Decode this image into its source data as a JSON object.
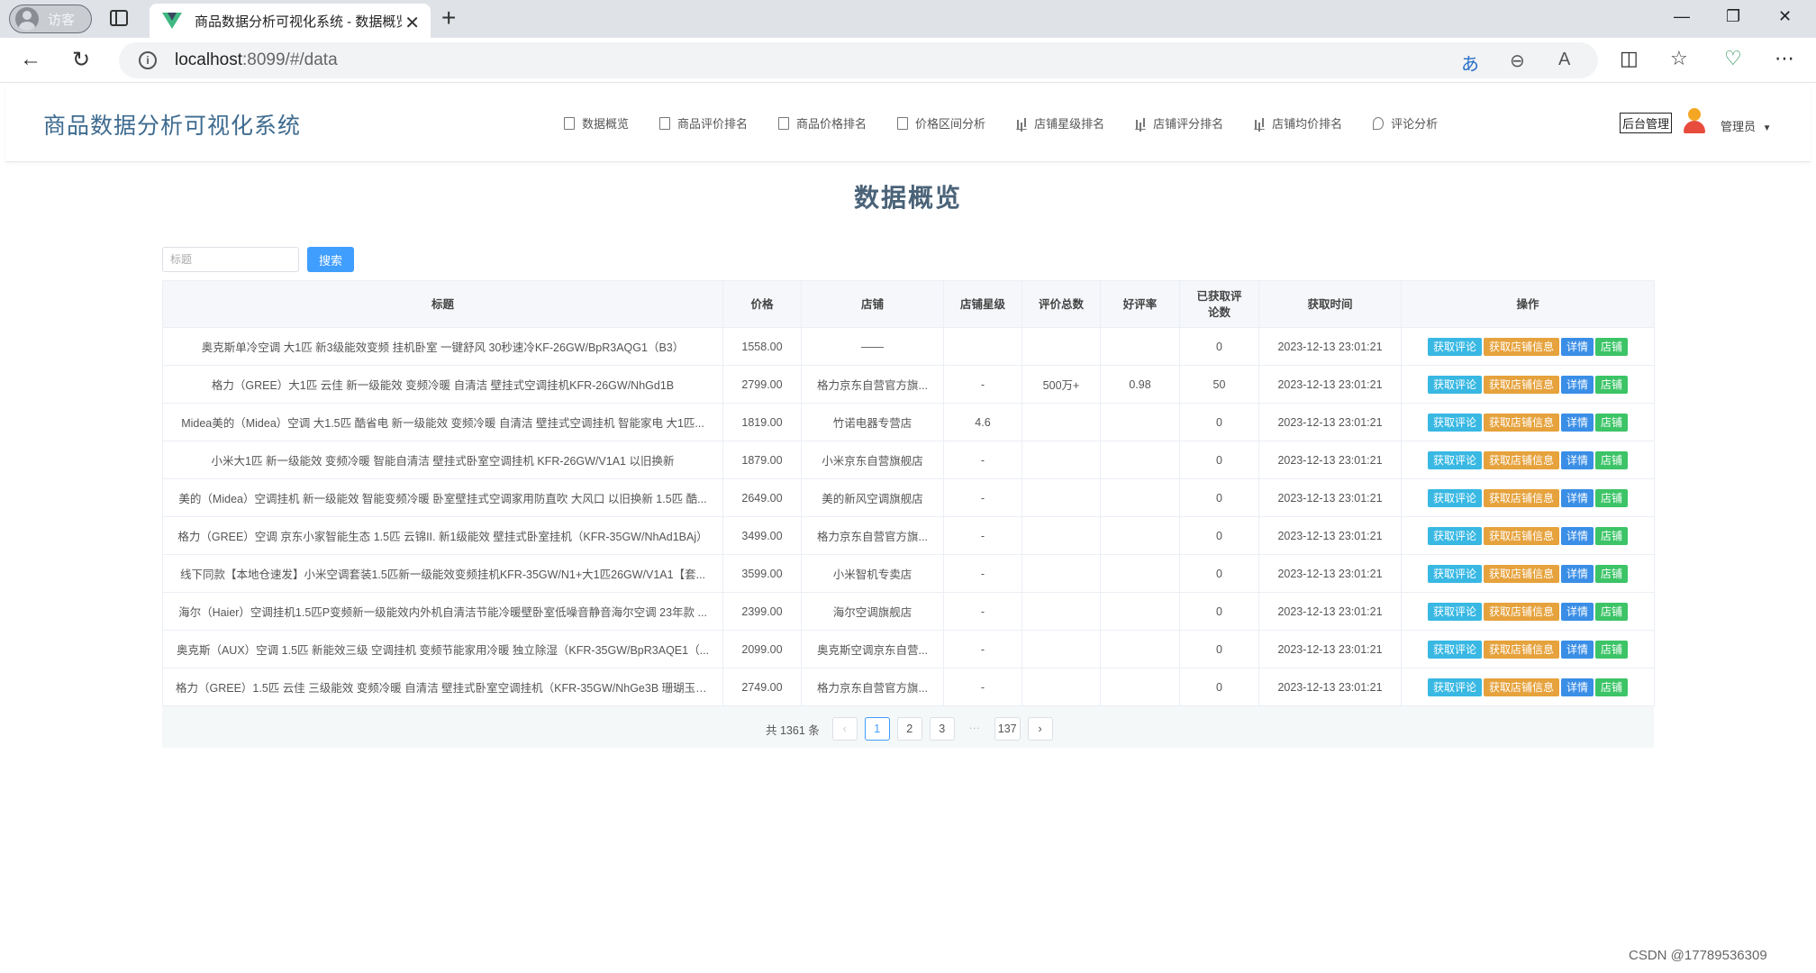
{
  "browser": {
    "profile_label": "访客",
    "tab_title": "商品数据分析可视化系统 - 数据概览",
    "url_host": "localhost",
    "url_rest": ":8099/#/data"
  },
  "app": {
    "title": "商品数据分析可视化系统",
    "nav": [
      {
        "label": "数据概览",
        "icon": "document-icon"
      },
      {
        "label": "商品评价排名",
        "icon": "list-icon"
      },
      {
        "label": "商品价格排名",
        "icon": "list-icon"
      },
      {
        "label": "价格区间分析",
        "icon": "list-icon"
      },
      {
        "label": "店铺星级排名",
        "icon": "bar-chart-icon"
      },
      {
        "label": "店铺评分排名",
        "icon": "bar-chart-icon"
      },
      {
        "label": "店铺均价排名",
        "icon": "bar-chart-icon"
      },
      {
        "label": "评论分析",
        "icon": "comment-icon"
      }
    ],
    "admin_label": "后台管理",
    "user_name": "管理员"
  },
  "page": {
    "heading": "数据概览",
    "search_placeholder": "标题",
    "search_button": "搜索"
  },
  "table": {
    "columns": [
      "标题",
      "价格",
      "店铺",
      "店铺星级",
      "评价总数",
      "好评率",
      "已获取评论数",
      "获取时间",
      "操作"
    ],
    "actions": [
      "获取评论",
      "获取店铺信息",
      "详情",
      "店铺"
    ],
    "rows": [
      {
        "title": "奥克斯单冷空调 大1匹 新3级能效变频 挂机卧室 一键舒风 30秒速冷KF-26GW/BpR3AQG1（B3）",
        "price": "1558.00",
        "shop": "——",
        "stars": "",
        "reviews": "",
        "rate": "",
        "fetched": "0",
        "time": "2023-12-13 23:01:21"
      },
      {
        "title": "格力（GREE）大1匹 云佳 新一级能效 变频冷暖 自清洁 壁挂式空调挂机KFR-26GW/NhGd1B",
        "price": "2799.00",
        "shop": "格力京东自营官方旗...",
        "stars": "-",
        "reviews": "500万+",
        "rate": "0.98",
        "fetched": "50",
        "time": "2023-12-13 23:01:21"
      },
      {
        "title": "Midea美的（Midea）空调 大1.5匹 酷省电 新一级能效 变频冷暖 自清洁 壁挂式空调挂机 智能家电 大1匹...",
        "price": "1819.00",
        "shop": "竹诺电器专营店",
        "stars": "4.6",
        "reviews": "",
        "rate": "",
        "fetched": "0",
        "time": "2023-12-13 23:01:21"
      },
      {
        "title": "小米大1匹 新一级能效 变频冷暖 智能自清洁 壁挂式卧室空调挂机 KFR-26GW/V1A1 以旧换新",
        "price": "1879.00",
        "shop": "小米京东自营旗舰店",
        "stars": "-",
        "reviews": "",
        "rate": "",
        "fetched": "0",
        "time": "2023-12-13 23:01:21"
      },
      {
        "title": "美的（Midea）空调挂机 新一级能效 智能变频冷暖 卧室壁挂式空调家用防直吹 大风口 以旧换新 1.5匹 酷...",
        "price": "2649.00",
        "shop": "美的新风空调旗舰店",
        "stars": "-",
        "reviews": "",
        "rate": "",
        "fetched": "0",
        "time": "2023-12-13 23:01:21"
      },
      {
        "title": "格力（GREE）空调 京东小家智能生态 1.5匹 云锦II. 新1级能效 壁挂式卧室挂机（KFR-35GW/NhAd1BAj）",
        "price": "3499.00",
        "shop": "格力京东自营官方旗...",
        "stars": "-",
        "reviews": "",
        "rate": "",
        "fetched": "0",
        "time": "2023-12-13 23:01:21"
      },
      {
        "title": "线下同款【本地仓速发】小米空调套装1.5匹新一级能效变频挂机KFR-35GW/N1+大1匹26GW/V1A1【套...",
        "price": "3599.00",
        "shop": "小米智机专卖店",
        "stars": "-",
        "reviews": "",
        "rate": "",
        "fetched": "0",
        "time": "2023-12-13 23:01:21"
      },
      {
        "title": "海尔（Haier）空调挂机1.5匹P变频新一级能效内外机自清洁节能冷暖壁卧室低噪音静音海尔空调 23年款 ...",
        "price": "2399.00",
        "shop": "海尔空调旗舰店",
        "stars": "-",
        "reviews": "",
        "rate": "",
        "fetched": "0",
        "time": "2023-12-13 23:01:21"
      },
      {
        "title": "奥克斯（AUX）空调 1.5匹 新能效三级 空调挂机 变频节能家用冷暖 独立除湿（KFR-35GW/BpR3AQE1（...",
        "price": "2099.00",
        "shop": "奥克斯空调京东自营...",
        "stars": "-",
        "reviews": "",
        "rate": "",
        "fetched": "0",
        "time": "2023-12-13 23:01:21"
      },
      {
        "title": "格力（GREE）1.5匹 云佳 三级能效 变频冷暖 自清洁 壁挂式卧室空调挂机（KFR-35GW/NhGe3B 珊瑚玉色...",
        "price": "2749.00",
        "shop": "格力京东自营官方旗...",
        "stars": "-",
        "reviews": "",
        "rate": "",
        "fetched": "0",
        "time": "2023-12-13 23:01:21"
      }
    ]
  },
  "pagination": {
    "total": "共 1361 条",
    "prev": "‹",
    "pages": [
      "1",
      "2",
      "3",
      "···",
      "137"
    ],
    "next": "›",
    "current": "1"
  },
  "watermark": "CSDN @17789536309",
  "colors": {
    "primary": "#409eff",
    "title": "#3e6b8f",
    "btn_cyan": "#38b8e3",
    "btn_orange": "#e6a23c",
    "btn_blue": "#3a8ee6",
    "btn_green": "#3cc467"
  }
}
